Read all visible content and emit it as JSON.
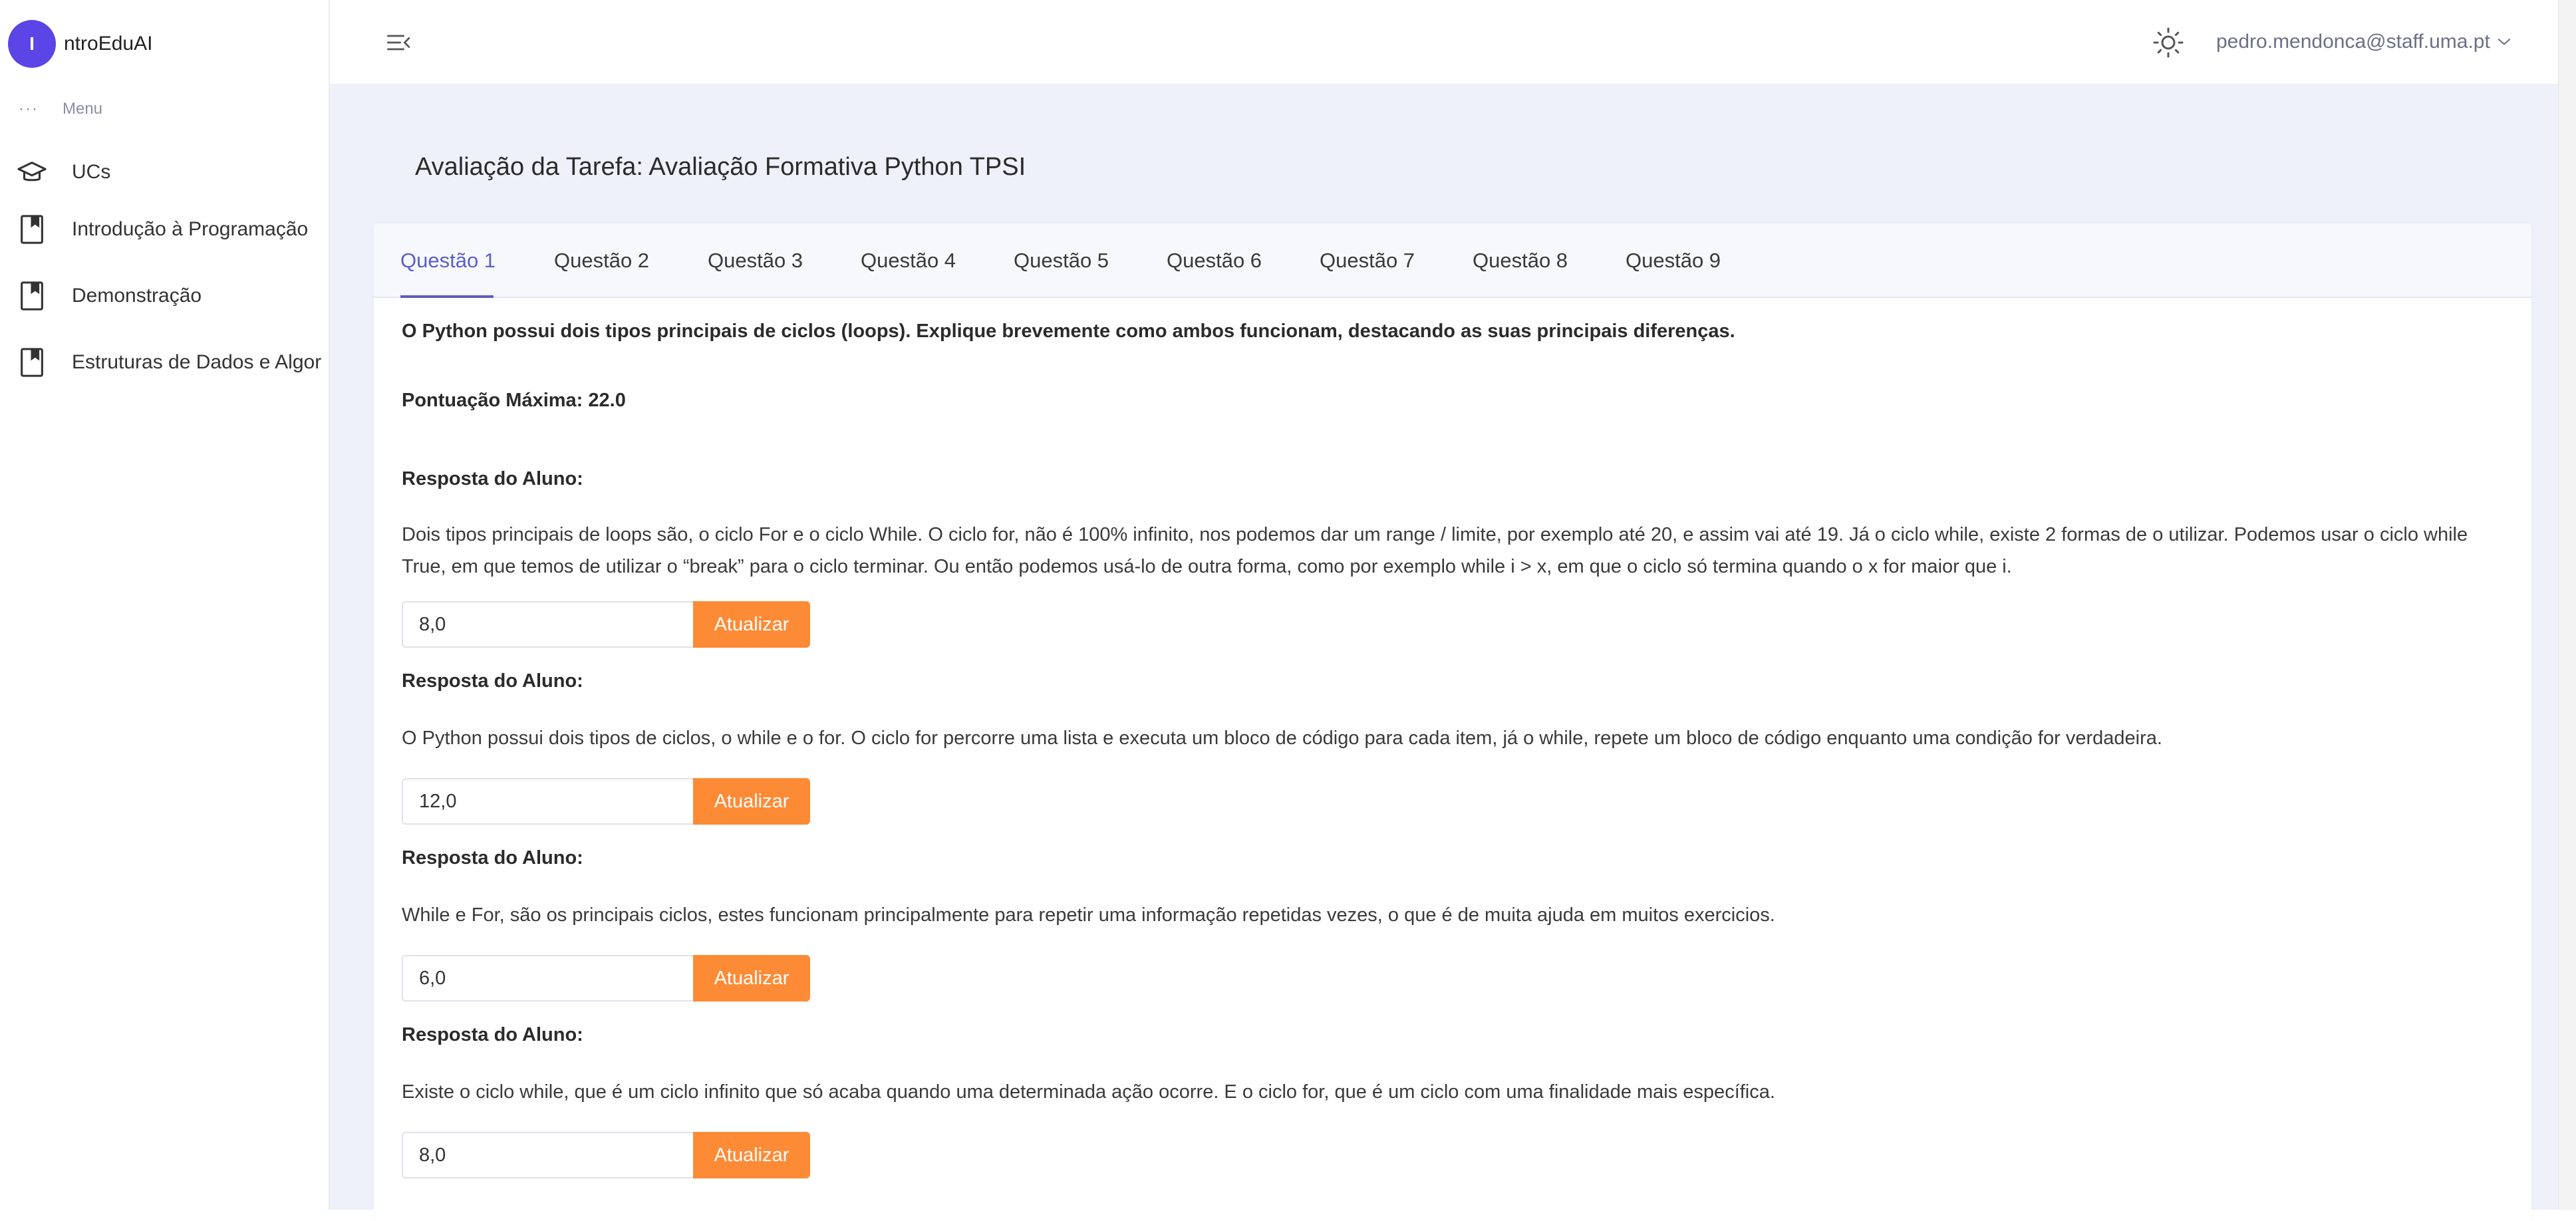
{
  "app": {
    "logo_letter": "I",
    "name": "ntroEduAI",
    "brand_color": "#5b45e6"
  },
  "sidebar": {
    "menu_dots": "···",
    "menu_heading": "Menu",
    "items": [
      {
        "icon": "graduation-cap-icon",
        "label": "UCs"
      },
      {
        "icon": "bookmark-book-icon",
        "label": "Introdução à Programação"
      },
      {
        "icon": "bookmark-book-icon",
        "label": "Demonstração"
      },
      {
        "icon": "bookmark-book-icon",
        "label": "Estruturas de Dados e Algor"
      }
    ]
  },
  "header": {
    "collapse_icon": "menu-collapse-icon",
    "theme_icon": "sun-icon",
    "user_email": "pedro.mendonca@staff.uma.pt",
    "user_chevron_icon": "chevron-down-icon"
  },
  "page": {
    "title": "Avaliação da Tarefa: Avaliação Formativa Python TPSI",
    "tabs": [
      "Questão 1",
      "Questão 2",
      "Questão 3",
      "Questão 4",
      "Questão 5",
      "Questão 6",
      "Questão 7",
      "Questão 8",
      "Questão 9"
    ],
    "active_tab_index": 0,
    "question_text": "O Python possui dois tipos principais de ciclos (loops). Explique brevemente como ambos funcionam, destacando as suas principais diferenças.",
    "max_score": "Pontuação Máxima: 22.0",
    "responses": [
      {
        "label": "Resposta do Aluno:",
        "text": "Dois tipos principais de loops são, o ciclo For e o ciclo While. O ciclo for, não é 100% infinito, nos podemos dar um range / limite, por exemplo até 20, e assim vai até 19. Já o ciclo while, existe 2 formas de o utilizar. Podemos usar o ciclo while True, em que temos de utilizar o “break” para o ciclo terminar. Ou então podemos usá-lo de outra forma, como por exemplo while i > x, em que o ciclo só termina quando o x for maior que i.",
        "grade": "8,0",
        "button": "Atualizar"
      },
      {
        "label": "Resposta do Aluno:",
        "text": "O Python possui dois tipos de ciclos, o while e o for. O ciclo for percorre uma lista e executa um bloco de código para cada item, já o while, repete um bloco de código enquanto uma condição for verdadeira.",
        "grade": "12,0",
        "button": "Atualizar"
      },
      {
        "label": "Resposta do Aluno:",
        "text": "While e For, são os principais ciclos, estes funcionam principalmente para repetir uma informação repetidas vezes, o que é de muita ajuda em muitos exercicios.",
        "grade": "6,0",
        "button": "Atualizar"
      },
      {
        "label": "Resposta do Aluno:",
        "text": "Existe o ciclo while, que é um ciclo infinito que só acaba quando uma determinada ação ocorre. E o ciclo for, que é um ciclo com uma finalidade mais específica.",
        "grade": "8,0",
        "button": "Atualizar"
      }
    ]
  },
  "colors": {
    "accent": "#5b5fc7",
    "button": "#fd8b36",
    "content_bg": "#eef1f9"
  }
}
